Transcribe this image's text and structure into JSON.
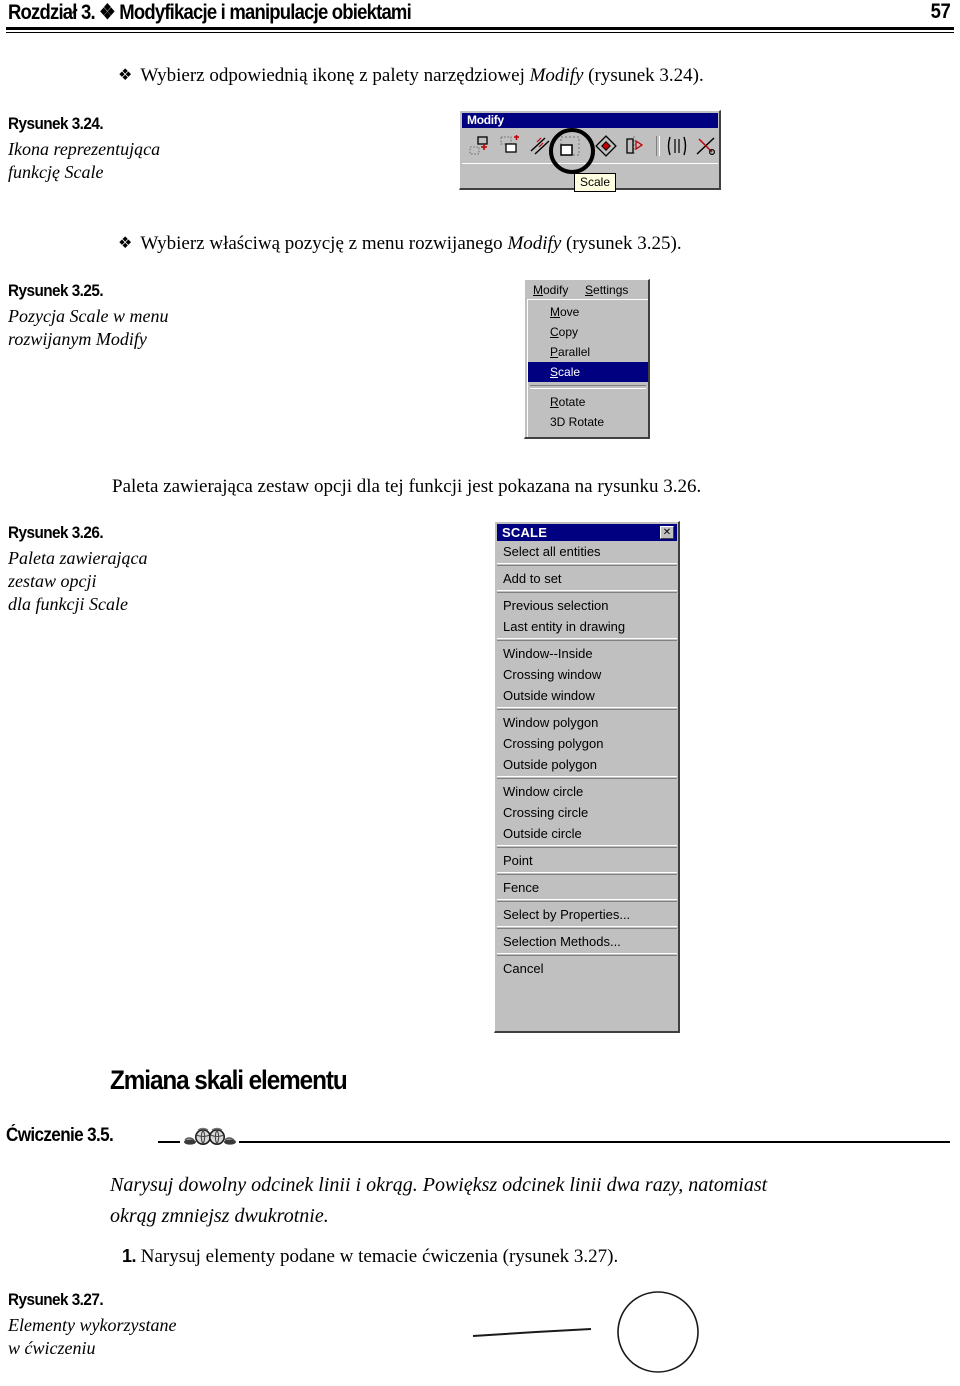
{
  "header": {
    "chapter": "Rozdział 3.",
    "ornament": "❖",
    "title": "Modyfikacje i manipulacje obiektami",
    "full_title": "Rozdział 3. ❖ Modyfikacje i manipulacje obiektami",
    "page_number": "57"
  },
  "bullets": [
    {
      "glyph": "❖",
      "text_before": "Wybierz odpowiednią ikonę z palety narzędziowej ",
      "emphasis": "Modify",
      "text_after": " (rysunek 3.24)."
    },
    {
      "glyph": "❖",
      "text_before": "Wybierz właściwą pozycję z menu rozwijanego ",
      "emphasis": "Modify",
      "text_after": " (rysunek 3.25)."
    }
  ],
  "paragraphs": {
    "palette_intro": "Paleta zawierająca zestaw opcji dla tej funkcji jest pokazana na rysunku 3.26."
  },
  "figures": [
    {
      "number": "Rysunek 3.24.",
      "description_line1": "Ikona reprezentująca",
      "description_line2": "funkcję Scale"
    },
    {
      "number": "Rysunek 3.25.",
      "description_line1": "Pozycja Scale w menu",
      "description_line2": "rozwijanym Modify"
    },
    {
      "number": "Rysunek 3.26.",
      "description_line1": "Paleta zawierająca",
      "description_line2": "zestaw opcji",
      "description_line3": "dla funkcji Scale"
    },
    {
      "number": "Rysunek 3.27.",
      "description_line1": "Elementy wykorzystane",
      "description_line2": "w ćwiczeniu"
    }
  ],
  "modify_toolbar": {
    "title": "Modify",
    "titlebar_color": "#000080",
    "face_color": "#c0c0c0",
    "tooltip": "Scale",
    "highlighted_index": 3,
    "icons": [
      "move-icon",
      "copy-icon",
      "parallel-icon",
      "scale-icon",
      "rotate-icon",
      "mirror-icon",
      "stretch-icon",
      "trim-icon"
    ]
  },
  "modify_menu": {
    "menubar": [
      {
        "label": "Modify",
        "accel": "M"
      },
      {
        "label": "Settings",
        "accel": "S"
      }
    ],
    "items": [
      {
        "label": "Move",
        "accel": "M",
        "selected": false,
        "divider_after": false
      },
      {
        "label": "Copy",
        "accel": "C",
        "selected": false,
        "divider_after": false
      },
      {
        "label": "Parallel",
        "accel": "P",
        "selected": false,
        "divider_after": false
      },
      {
        "label": "Scale",
        "accel": "S",
        "selected": true,
        "divider_after": true
      },
      {
        "label": "Rotate",
        "accel": "R",
        "selected": false,
        "divider_after": false
      },
      {
        "label": "3D Rotate",
        "accel": "",
        "selected": false,
        "divider_after": false
      }
    ],
    "highlight_color": "#000080"
  },
  "scale_palette": {
    "title": "SCALE",
    "close_label": "✕",
    "titlebar_color": "#000080",
    "face_color": "#c0c0c0",
    "groups": [
      [
        "Select all entities"
      ],
      [
        "Add to set"
      ],
      [
        "Previous selection",
        "Last entity in drawing"
      ],
      [
        "Window--Inside",
        "Crossing window",
        "Outside window"
      ],
      [
        "Window polygon",
        "Crossing polygon",
        "Outside polygon"
      ],
      [
        "Window circle",
        "Crossing circle",
        "Outside circle"
      ],
      [
        "Point"
      ],
      [
        "Fence"
      ],
      [
        "Select by Properties..."
      ],
      [
        "Selection Methods..."
      ],
      [
        "Cancel"
      ]
    ]
  },
  "section": {
    "heading": "Zmiana skali elementu"
  },
  "exercise": {
    "label": "Ćwiczenie 3.5.",
    "body_line1": "Narysuj dowolny odcinek linii i okrąg. Powiększ odcinek linii dwa razy, natomiast",
    "body_line2": "okrąg zmniejsz dwukrotnie.",
    "step_number": "1.",
    "step_text": "Narysuj elementy podane w temacie ćwiczenia (rysunek 3.27)."
  },
  "fig327": {
    "shapes": [
      "line-segment",
      "circle"
    ]
  }
}
